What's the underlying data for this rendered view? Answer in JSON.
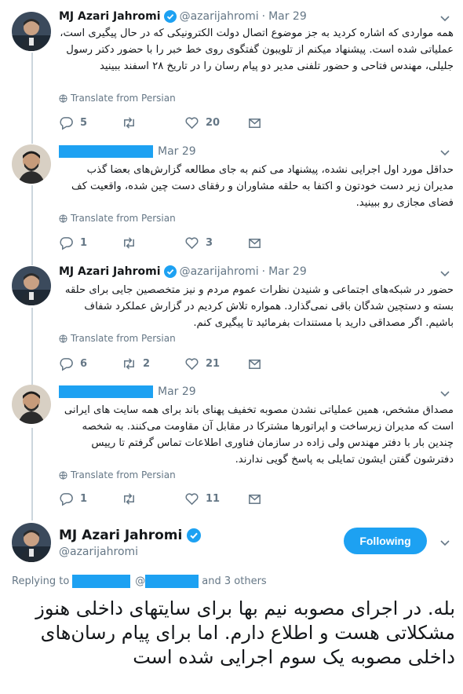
{
  "tweets": [
    {
      "name": "MJ Azari Jahromi",
      "handle": "@azarijahromi",
      "time": "Mar 29",
      "text": "همه مواردی که اشاره کردید به جز موضوع اتصال دولت الکترونیکی که در حال پیگیری است، عملیاتی شده است. پیشنهاد میکنم از تلویبون گفتگوی روی خط خبر را با حضور دکتر رسول جلیلی، مهندس فتاحی و حضور تلفنی مدیر دو پیام رسان را در تاریخ ۲۸ اسفند ببینید",
      "translate": "Translate from Persian",
      "replies": "5",
      "retweets": "",
      "likes": "20"
    },
    {
      "name": "",
      "handle": "",
      "time": "Mar 29",
      "text": "حداقل مورد اول اجرایی نشده، پیشنهاد می کنم به جای مطالعه گزارش‌های بعضا گذب مدیران زیر دست خودتون و اکتفا به حلقه مشاوران و رفقای دست چین شده، واقعیت کف فضای مجازی رو ببینید.",
      "translate": "Translate from Persian",
      "replies": "1",
      "retweets": "",
      "likes": "3"
    },
    {
      "name": "MJ Azari Jahromi",
      "handle": "@azarijahromi",
      "time": "Mar 29",
      "text": "حضور در شبکه‌های اجتماعی و شنیدن نظرات عموم مردم و نیز متخصصین جایی برای حلقه بسته و دستچین شدگان باقی نمی‌گذارد. همواره تلاش کردیم در گزارش عملکرد شفاف باشیم. اگر مصداقی دارید با مستندات بفرمائید تا پیگیری کنم.",
      "translate": "Translate from Persian",
      "replies": "6",
      "retweets": "2",
      "likes": "21"
    },
    {
      "name": "",
      "handle": "",
      "time": "Mar 29",
      "text": "مصداق مشخص، همین عملیاتی نشدن مصوبه تخفیف پهنای باند برای همه سایت های ایرانی است که مدیران زیرساخت و اپراتورها مشترکا در مقابل آن مقاومت می‌کنند. به شخصه چندین بار با دفتر مهندس ولی زاده در سازمان فناوری اطلاعات تماس گرفتم تا رییس دفترشون گفتن ایشون تمایلی به پاسخ گویی ندارند.",
      "translate": "Translate from Persian",
      "replies": "1",
      "retweets": "",
      "likes": "11"
    }
  ],
  "main_tweet": {
    "name": "MJ Azari Jahromi",
    "handle": "@azarijahromi",
    "follow_label": "Following",
    "replying_prefix": "Replying to",
    "replying_at": "@",
    "replying_suffix": "and 3 others",
    "text": "بله. در اجرای مصوبه نیم بها برای سایتهای داخلی هنوز مشکلاتی هست و اطلاع دارم. اما برای پیام رسان‌های داخلی مصوبه یک سوم اجرایی شده است"
  },
  "colors": {
    "accent": "#1da1f2",
    "muted": "#657786",
    "thread_line": "#ccd6dd",
    "heart": "#657786"
  },
  "icons": [
    "verified-icon",
    "chevron-down-icon",
    "globe-icon",
    "reply-icon",
    "retweet-icon",
    "like-icon",
    "message-icon"
  ]
}
